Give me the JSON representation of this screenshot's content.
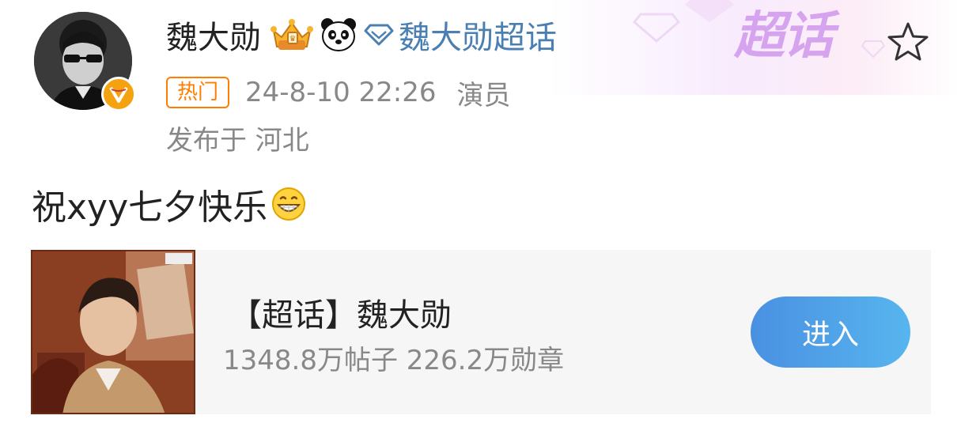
{
  "header": {
    "username": "魏大勋",
    "topic_name": "魏大勋超话",
    "hot_badge": "热门",
    "timestamp": "24-8-10 22:26",
    "role": "演员",
    "location": "发布于 河北",
    "watermark": "超话"
  },
  "post": {
    "text": "祝xyy七夕快乐"
  },
  "card": {
    "title": "【超话】魏大勋",
    "stats": "1348.8万帖子 226.2万勋章",
    "enter_label": "进入"
  },
  "icons": {
    "verified": "verified-v-icon",
    "crown": "crown-badge-icon",
    "panda": "panda-icon",
    "topic": "diamond-topic-icon",
    "favorite": "star-icon",
    "emoji": "grin-emoji-icon"
  },
  "colors": {
    "link_blue": "#4a7fb2",
    "hot_orange": "#ff7d00",
    "verified_gold": "#f4a20f",
    "button_blue": "#4a90e2"
  }
}
